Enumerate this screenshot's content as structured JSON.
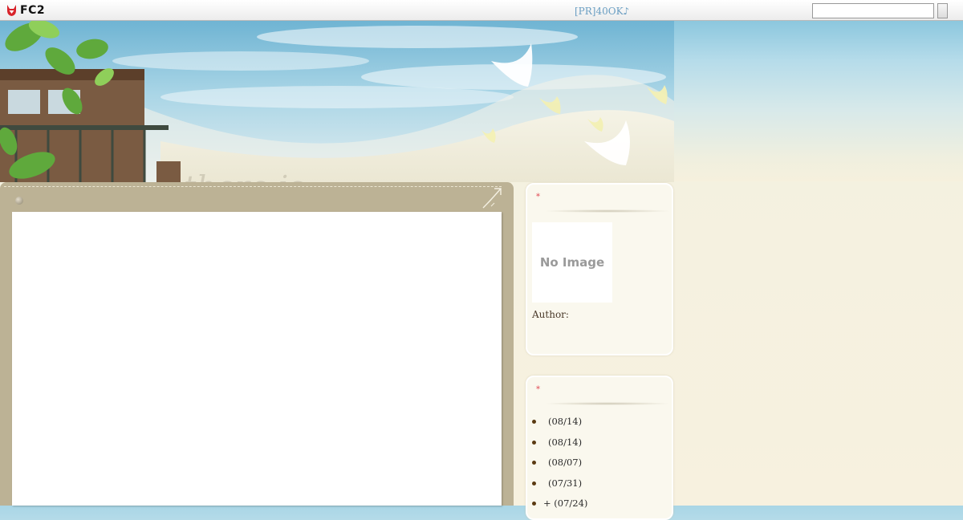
{
  "topbar": {
    "logo_text": "FC2",
    "pr_link": "[PR]40OK♪",
    "search_value": "",
    "search_button_label": ""
  },
  "header": {
    "tagline": "there is..."
  },
  "sidebar": {
    "profile": {
      "marker": "*",
      "image_text": "No Image",
      "author_label": "Author:"
    },
    "entries": {
      "marker": "*",
      "items": [
        {
          "text": "(08/14)"
        },
        {
          "text": "(08/14)"
        },
        {
          "text": "(08/07)"
        },
        {
          "text": "(07/31)"
        },
        {
          "text": "+ (07/24)"
        }
      ]
    }
  },
  "colors": {
    "accent_marker": "#e04b55",
    "panel": "#bcb295",
    "link": "#6a9ec2"
  }
}
